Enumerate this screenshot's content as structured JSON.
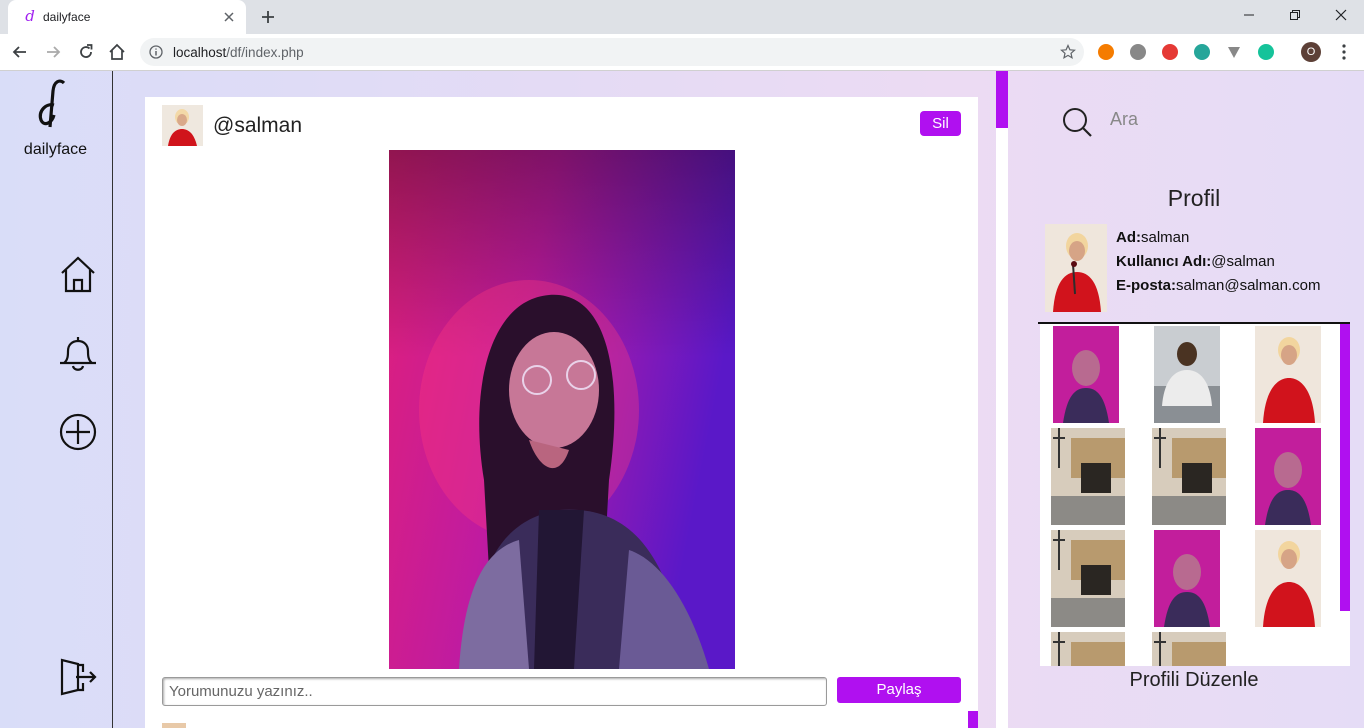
{
  "browser": {
    "tab_title": "dailyface",
    "url_host": "localhost",
    "url_path": "/df/index.php",
    "profile_initial": "O"
  },
  "app": {
    "logo_text": "dailyface",
    "accent_color": "#b010f0"
  },
  "nav": {
    "items": [
      "home-icon",
      "bell-icon",
      "add-circle-icon",
      "logout-icon"
    ]
  },
  "post": {
    "username": "@salman",
    "delete_label": "Sil",
    "comment_placeholder": "Yorumunuzu yazınız..",
    "share_label": "Paylaş"
  },
  "sidebar": {
    "search_placeholder": "Ara",
    "profile_heading": "Profil",
    "name_label": "Ad:",
    "name_value": "salman",
    "username_label": "Kullanıcı Adı:",
    "username_value": "@salman",
    "email_label": "E-posta:",
    "email_value": "salman@salman.com",
    "edit_label": "Profili Düzenle"
  }
}
